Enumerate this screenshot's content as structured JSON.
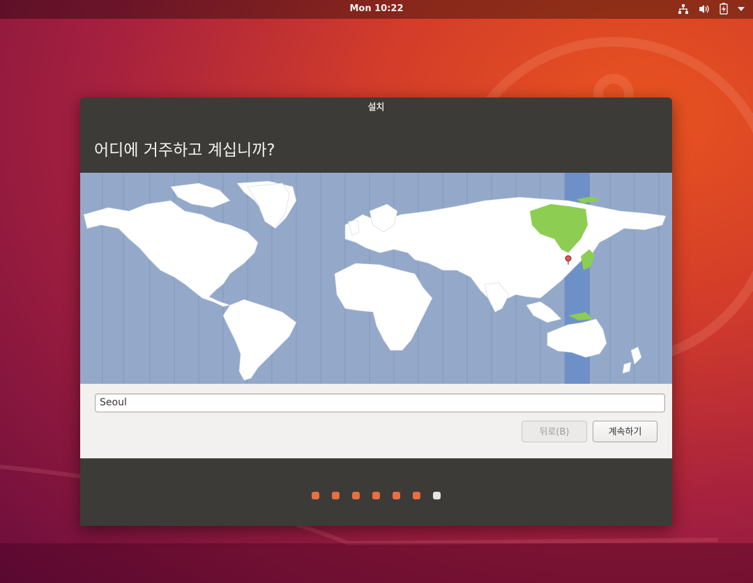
{
  "topbar": {
    "clock": "Mon 10:22",
    "icons": [
      "network-icon",
      "volume-icon",
      "battery-icon",
      "menu-arrow-icon"
    ]
  },
  "window": {
    "title": "설치",
    "heading": "어디에 거주하고 계십니까?",
    "map": {
      "selected_city": "Seoul",
      "highlight_color": "#8ccd52",
      "ocean_color": "#94a9c9",
      "timezone_band_color": "#6e90c8"
    },
    "city_field": {
      "value": "Seoul"
    },
    "buttons": {
      "back": "뒤로(B)",
      "continue": "계속하기"
    },
    "progress": {
      "total": 7,
      "current": 7,
      "active_color": "#e86e43",
      "current_color": "#e4e4e4"
    }
  }
}
